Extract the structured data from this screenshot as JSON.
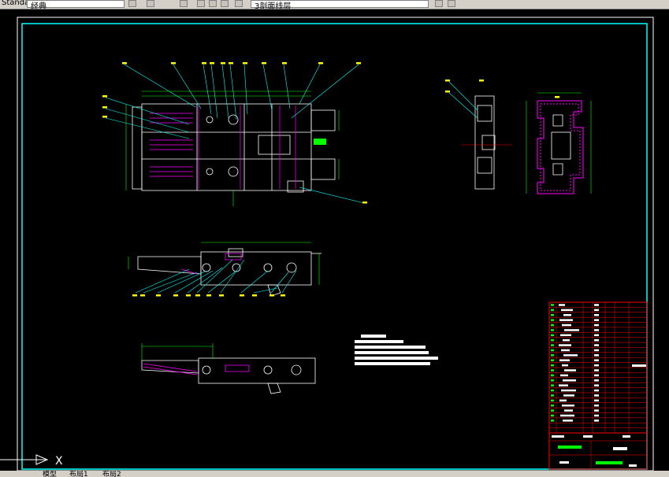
{
  "toolbar": {
    "style_combo": "Standard",
    "layer_combo_value": "3剖面线层",
    "left_label": "经典"
  },
  "ucs": {
    "x_label": "X"
  },
  "layout_tabs": [
    "模型",
    "布局1",
    "布局2"
  ],
  "colors": {
    "background": "#000000",
    "frame": "#00ffff",
    "drawing": "#ffffff",
    "leader": "#00ffff",
    "numbers": "#ffff00",
    "hatch": "#ff00ff",
    "title_block": "#ff0000",
    "dimension": "#00ff00"
  }
}
